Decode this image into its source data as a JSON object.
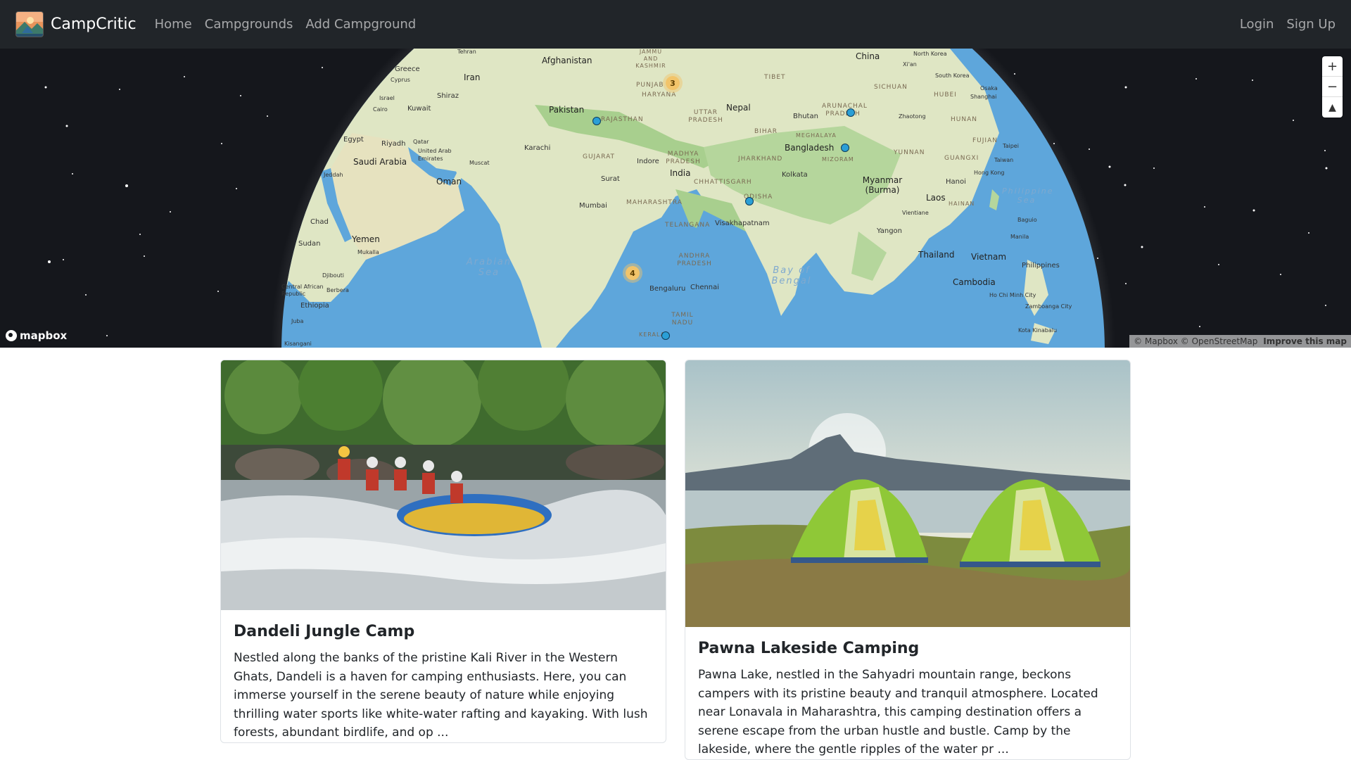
{
  "navbar": {
    "brand": "CampCritic",
    "links": [
      "Home",
      "Campgrounds",
      "Add Campground"
    ],
    "right_links": [
      "Login",
      "Sign Up"
    ]
  },
  "map": {
    "countries": [
      "Afghanistan",
      "Iran",
      "Pakistan",
      "Nepal",
      "China",
      "India",
      "Bangladesh",
      "Bhutan",
      "Myanmar (Burma)",
      "Laos",
      "Thailand",
      "Vietnam",
      "Cambodia",
      "Philippines",
      "Oman",
      "Saudi Arabia",
      "Yemen",
      "Egypt",
      "Sudan",
      "Chad",
      "Ethiopia",
      "Djibouti",
      "Greece",
      "Cyprus",
      "Israel",
      "Kuwait",
      "Qatar",
      "United Arab Emirates",
      "Central African Republic"
    ],
    "cities": [
      "Tehran",
      "Shiraz",
      "Cairo",
      "Riyadh",
      "Muscat",
      "Karachi",
      "Mumbai",
      "Surat",
      "Indore",
      "Kolkata",
      "Visakhapatnam",
      "Bengaluru",
      "Chennai",
      "Yangon",
      "Vientiane",
      "Hanoi",
      "Hong Kong",
      "Taipei",
      "Taiwan",
      "Manila",
      "Baguio",
      "Ho Chi Minh City",
      "Zamboanga City",
      "Kota Kinabalu",
      "Xi'an",
      "Shanghai",
      "Zhaotong",
      "North Korea",
      "South Korea",
      "Osaka",
      "Mukalla",
      "Jeddah",
      "Berbera",
      "Juba",
      "Kisangani"
    ],
    "regions": [
      "JAMMU AND KASHMIR",
      "PUNJAB",
      "HARYANA",
      "UTTAR PRADESH",
      "TIBET",
      "SICHUAN",
      "HUBEI",
      "ARUNACHAL PRADESH",
      "MEGHALAYA",
      "MIZORAM",
      "YUNNAN",
      "GUANGXI",
      "FUJIAN",
      "HUNAN",
      "HAINAN",
      "RAJASTHAN",
      "GUJARAT",
      "MADHYA PRADESH",
      "BIHAR",
      "JHARKHAND",
      "CHHATTISGARH",
      "MAHARASHTRA",
      "ODISHA",
      "TELANGANA",
      "ANDHRA PRADESH",
      "TAMIL NADU",
      "KERALA"
    ],
    "seas": [
      "Arabian Sea",
      "Bay of Bengal",
      "Philippine Sea"
    ],
    "clusters": [
      "3",
      "4"
    ],
    "zoom_in": "+",
    "zoom_out": "−",
    "compass": "▲",
    "mapbox_logo": "mapbox",
    "attribution": "© Mapbox © OpenStreetMap",
    "improve": "Improve this map"
  },
  "cards": [
    {
      "title": "Dandeli Jungle Camp",
      "text": "Nestled along the banks of the pristine Kali River in the Western Ghats, Dandeli is a haven for camping enthusiasts. Here, you can immerse yourself in the serene beauty of nature while enjoying thrilling water sports like white-water rafting and kayaking. With lush forests, abundant birdlife, and op ..."
    },
    {
      "title": "Pawna Lakeside Camping",
      "text": "Pawna Lake, nestled in the Sahyadri mountain range, beckons campers with its pristine beauty and tranquil atmosphere. Located near Lonavala in Maharashtra, this camping destination offers a serene escape from the urban hustle and bustle. Camp by the lakeside, where the gentle ripples of the water pr ..."
    }
  ]
}
